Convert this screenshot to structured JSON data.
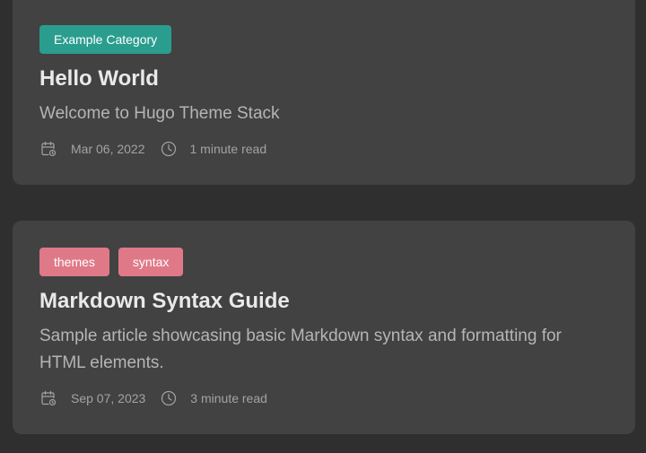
{
  "articles": [
    {
      "tags": [
        "Example Category"
      ],
      "title": "Hello World",
      "subtitle": "Welcome to Hugo Theme Stack",
      "date": "Mar 06, 2022",
      "read_time": "1 minute read"
    },
    {
      "tags": [
        "themes",
        "syntax"
      ],
      "title": "Markdown Syntax Guide",
      "subtitle": "Sample article showcasing basic Markdown syntax and formatting for HTML elements.",
      "date": "Sep 07, 2023",
      "read_time": "3 minute read"
    }
  ],
  "colors": {
    "background": "#2f2f2f",
    "card": "#424242",
    "category_tag": "#2a9d8f",
    "keyword_tag": "#df7988",
    "title": "#e9e9e9",
    "subtitle": "#b5b5b5",
    "meta": "#a3a3a3"
  },
  "icons": {
    "date": "calendar-clock-icon",
    "read_time": "clock-icon"
  }
}
